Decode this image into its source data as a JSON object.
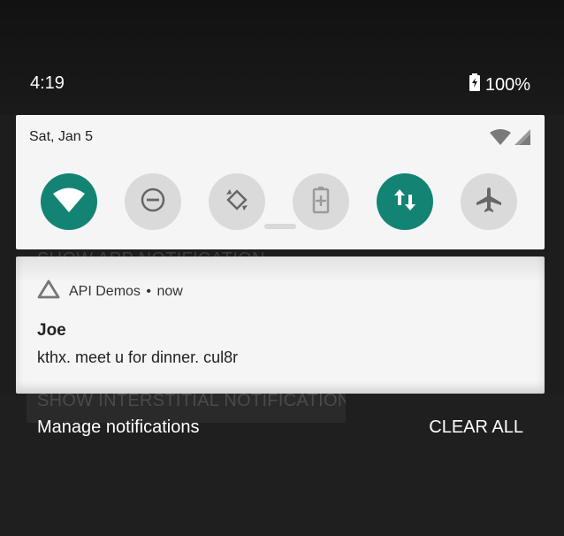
{
  "status_bar": {
    "time": "4:19",
    "battery": "100%",
    "battery_icon": "battery-charging-icon"
  },
  "quick_settings": {
    "date": "Sat, Jan 5",
    "tiles": [
      {
        "name": "wifi",
        "icon": "wifi-icon",
        "state": "on"
      },
      {
        "name": "do-not-disturb",
        "icon": "minus-circle-icon",
        "state": "off"
      },
      {
        "name": "auto-rotate",
        "icon": "rotate-icon",
        "state": "off"
      },
      {
        "name": "battery-saver",
        "icon": "battery-plus-icon",
        "state": "off"
      },
      {
        "name": "mobile-data",
        "icon": "data-arrows-icon",
        "state": "on"
      },
      {
        "name": "airplane-mode",
        "icon": "airplane-icon",
        "state": "off"
      }
    ],
    "colors": {
      "active": "#138473",
      "inactive": "#dadada",
      "panel": "#f5f5f5"
    }
  },
  "background_buttons": {
    "top": "SHOW APP NOTIFICATION",
    "bottom": "SHOW INTERSTITIAL NOTIFICATION"
  },
  "notification": {
    "app_name": "API Demos",
    "separator": "•",
    "time": "now",
    "title": "Joe",
    "text": "kthx. meet u for dinner. cul8r",
    "icon": "triangle-icon"
  },
  "footer": {
    "manage_label": "Manage notifications",
    "clear_label": "CLEAR ALL"
  }
}
